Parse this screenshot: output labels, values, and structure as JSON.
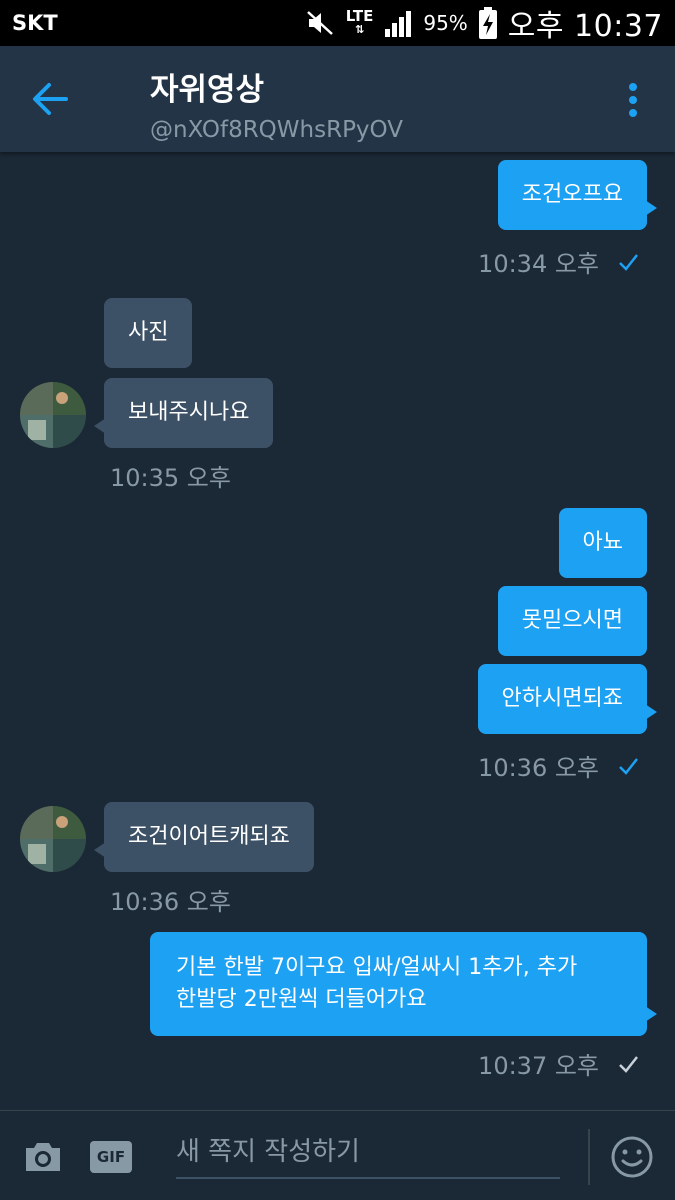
{
  "status_bar": {
    "carrier": "SKT",
    "network": "LTE",
    "battery": "95%",
    "time": "오후 10:37"
  },
  "header": {
    "title": "자위영상",
    "handle": "@nXOf8RQWhsRPyOV"
  },
  "messages": [
    {
      "direction": "out",
      "text": "조건오프요"
    },
    {
      "meta": "10:34 오후"
    },
    {
      "direction": "in",
      "text": "사진"
    },
    {
      "direction": "in",
      "text": "보내주시나요"
    },
    {
      "meta": "10:35 오후"
    },
    {
      "direction": "out",
      "text": "아뇨"
    },
    {
      "direction": "out",
      "text": "못믿으시면"
    },
    {
      "direction": "out",
      "text": "안하시면되죠"
    },
    {
      "meta": "10:36 오후"
    },
    {
      "direction": "in",
      "text": "조건이어트캐되죠"
    },
    {
      "meta": "10:36 오후"
    },
    {
      "direction": "out",
      "text_lines": [
        "기본 한발 7이구요 입싸/얼싸시 1추가, 추가",
        "한발당 2만원씩 더들어가요"
      ]
    },
    {
      "meta": "10:37 오후"
    }
  ],
  "composer": {
    "placeholder": "새 쪽지 작성하기",
    "gif_label": "GIF"
  },
  "colors": {
    "background": "#1b2836",
    "header": "#243447",
    "outgoing_bubble": "#1da1f2",
    "incoming_bubble": "#3d5166",
    "meta_text": "#8899a6",
    "accent": "#1da1f2"
  },
  "icons": {
    "back": "arrow-left-icon",
    "more": "more-vertical-icon",
    "read_receipt": "check-icon",
    "camera": "camera-icon",
    "emoji": "emoji-icon"
  }
}
